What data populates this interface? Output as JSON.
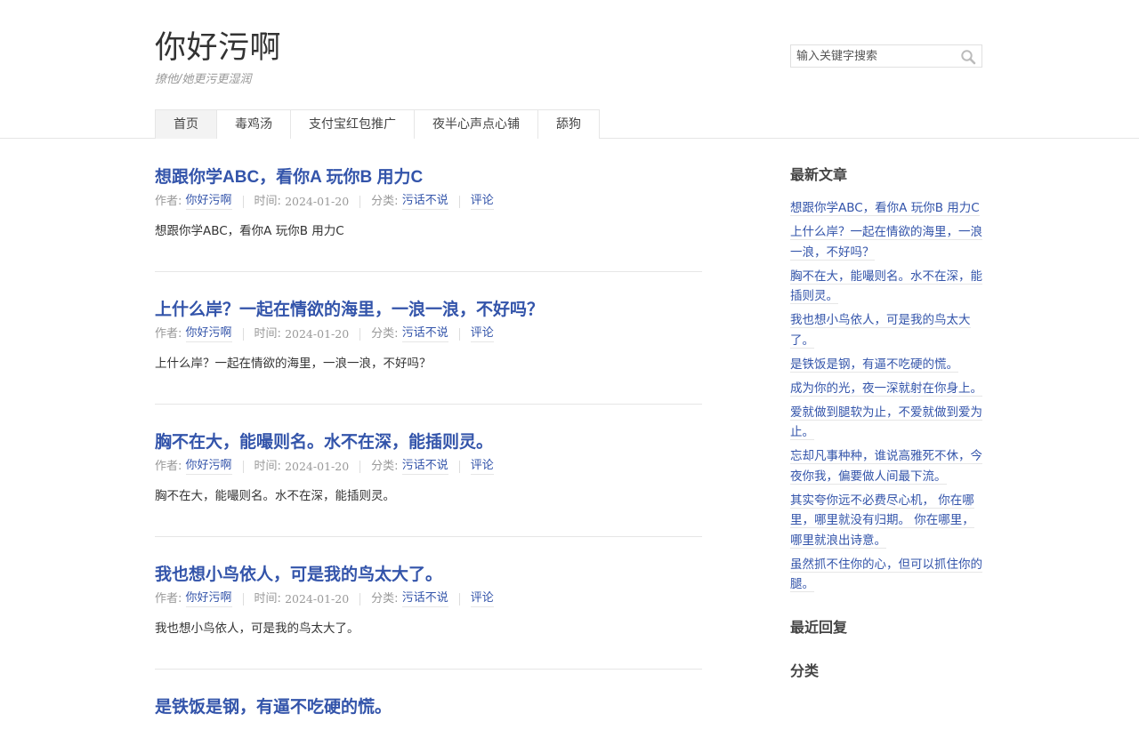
{
  "site": {
    "title": "你好污啊",
    "description": "撩他/她更污更湿润"
  },
  "search": {
    "placeholder": "输入关键字搜索"
  },
  "nav": [
    {
      "label": "首页"
    },
    {
      "label": "毒鸡汤"
    },
    {
      "label": "支付宝红包推广"
    },
    {
      "label": "夜半心声点心铺"
    },
    {
      "label": "舔狗"
    }
  ],
  "meta_labels": {
    "author": "作者: ",
    "time": "时间: ",
    "category": "分类: "
  },
  "posts": [
    {
      "title": "想跟你学ABC，看你A 玩你B 用力C",
      "author": "你好污啊",
      "date": "2024-01-20",
      "category": "污话不说",
      "comments": "评论",
      "excerpt": "想跟你学ABC，看你A 玩你B 用力C"
    },
    {
      "title": "上什么岸？一起在情欲的海里，一浪一浪，不好吗？",
      "author": "你好污啊",
      "date": "2024-01-20",
      "category": "污话不说",
      "comments": "评论",
      "excerpt": "上什么岸？一起在情欲的海里，一浪一浪，不好吗？"
    },
    {
      "title": "胸不在大，能嘬则名。水不在深，能插则灵。",
      "author": "你好污啊",
      "date": "2024-01-20",
      "category": "污话不说",
      "comments": "评论",
      "excerpt": "胸不在大，能嘬则名。水不在深，能插则灵。"
    },
    {
      "title": "我也想小鸟依人，可是我的鸟太大了。",
      "author": "你好污啊",
      "date": "2024-01-20",
      "category": "污话不说",
      "comments": "评论",
      "excerpt": "我也想小鸟依人，可是我的鸟太大了。"
    },
    {
      "title": "是铁饭是钢，有逼不吃硬的慌。",
      "author": "",
      "date": "",
      "category": "",
      "comments": "",
      "excerpt": ""
    }
  ],
  "sidebar": {
    "recent_posts_title": "最新文章",
    "recent_posts": [
      "想跟你学ABC，看你A 玩你B 用力C",
      "上什么岸？一起在情欲的海里，一浪一浪，不好吗？",
      "胸不在大，能嘬则名。水不在深，能插则灵。",
      "我也想小鸟依人，可是我的鸟太大了。",
      "是铁饭是钢，有逼不吃硬的慌。",
      "成为你的光，夜一深就射在你身上。",
      "爱就做到腿软为止，不爱就做到爱为止。",
      "忘却凡事种种，谁说高雅死不休，今夜你我，偏要做人间最下流。",
      "其实夸你远不必费尽心机， 你在哪里，哪里就没有归期。 你在哪里，哪里就浪出诗意。",
      "虽然抓不住你的心，但可以抓住你的腿。"
    ],
    "recent_comments_title": "最近回复",
    "categories_title": "分类"
  },
  "colors": {
    "link": "#3354aa",
    "text": "#333333",
    "muted": "#999999",
    "border": "#e6e6e6",
    "nav_current_bg": "#f3f3f3"
  }
}
